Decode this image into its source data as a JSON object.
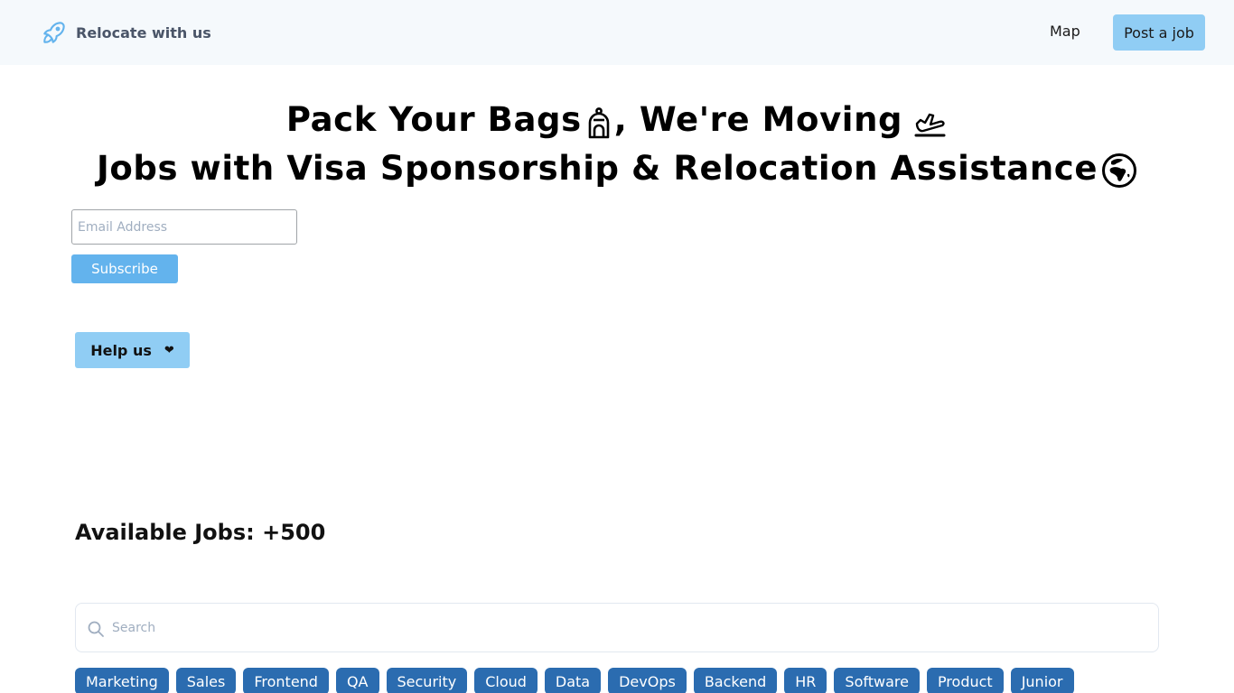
{
  "navbar": {
    "brand_icon": "rocket-icon",
    "brand_name": "Relocate with us",
    "links": [
      {
        "label": "Map"
      },
      {
        "label": "Post a job"
      }
    ]
  },
  "hero": {
    "line1_part1": "Pack Your Bags",
    "line1_emoji1": "backpack-icon",
    "line1_part2": ", We're Moving",
    "line1_emoji2": "airplane-departure-icon",
    "line2": "Jobs with Visa Sponsorship & Relocation Assistance",
    "line2_emoji": "globe-africa-icon"
  },
  "subscribe": {
    "email_placeholder": "Email Address",
    "email_value": "",
    "button_label": "Subscribe"
  },
  "help": {
    "label": "Help us",
    "icon": "heart-icon",
    "heart_glyph": "❤"
  },
  "jobs": {
    "heading": "Available Jobs: +500"
  },
  "search": {
    "icon": "search-icon",
    "placeholder": "Search",
    "value": ""
  },
  "tags": [
    "Marketing",
    "Sales",
    "Frontend",
    "QA",
    "Security",
    "Cloud",
    "Data",
    "DevOps",
    "Backend",
    "HR",
    "Software",
    "Product",
    "Junior"
  ],
  "colors": {
    "navbar_bg": "#f5f9fc",
    "brand_icon": "#63b3ed",
    "brand_text": "#4a5568",
    "post_job_bg": "#90cdf4",
    "subscribe_bg": "#63b3ed",
    "help_bg": "#90cdf4",
    "tag_bg": "#2b6cb0"
  }
}
